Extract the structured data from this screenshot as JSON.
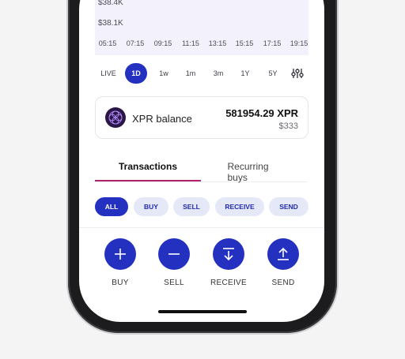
{
  "chart": {
    "y_labels": [
      "$38.4K",
      "$38.1K"
    ],
    "x_labels": [
      "05:15",
      "07:15",
      "09:15",
      "11:15",
      "13:15",
      "15:15",
      "17:15",
      "19:15"
    ]
  },
  "range_tabs": [
    "LIVE",
    "1D",
    "1w",
    "1m",
    "3m",
    "1Y",
    "5Y"
  ],
  "range_active": "1D",
  "balance": {
    "label": "XPR balance",
    "amount": "581954.29 XPR",
    "fiat": "$333"
  },
  "tabs": {
    "transactions": "Transactions",
    "recurring": "Recurring buys"
  },
  "filters": [
    "ALL",
    "BUY",
    "SELL",
    "RECEIVE",
    "SEND"
  ],
  "actions": [
    "BUY",
    "SELL",
    "RECEIVE",
    "SEND"
  ],
  "colors": {
    "accent": "#2430c0",
    "tab_underline": "#b1236a",
    "chip_bg": "#e5e8f7"
  }
}
